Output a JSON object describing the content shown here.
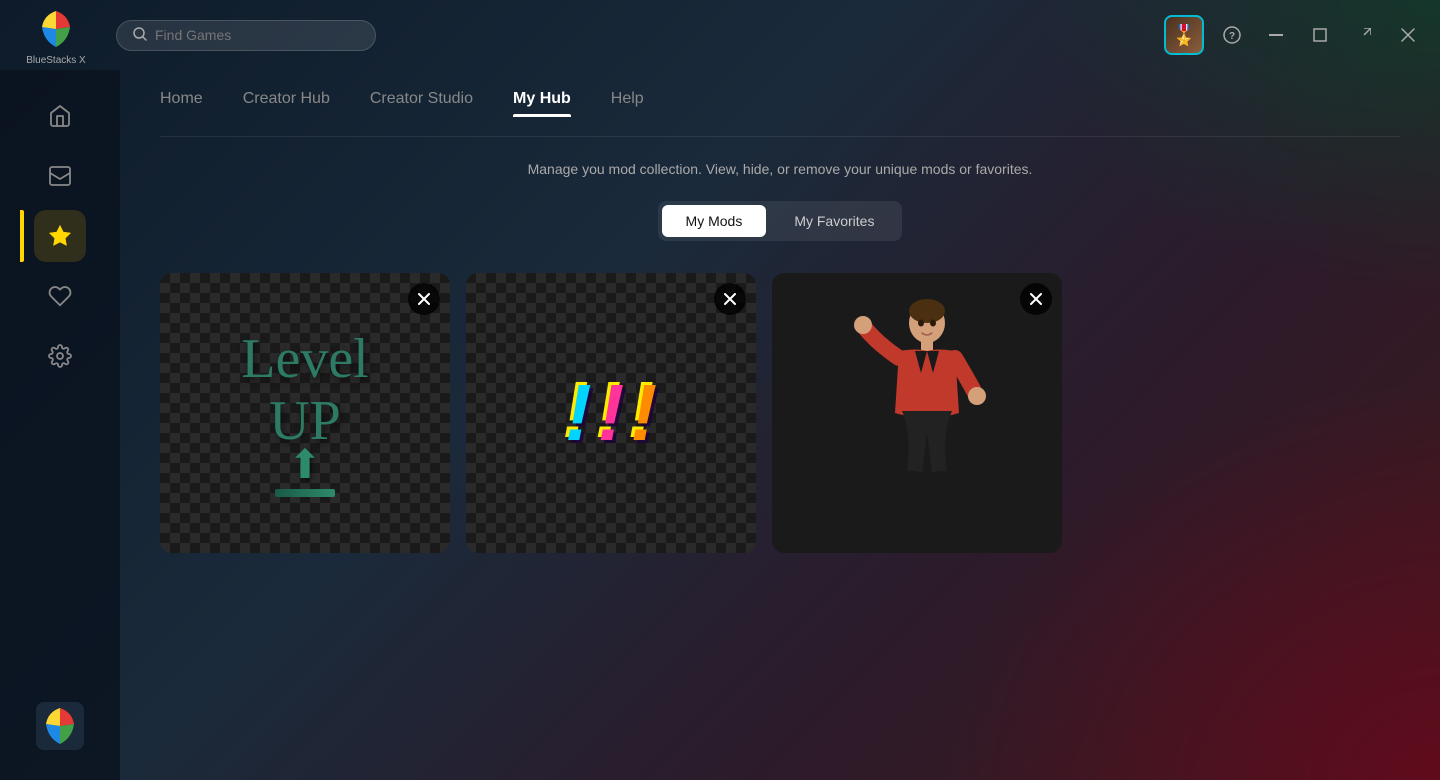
{
  "app": {
    "name": "BlueStacks X",
    "logo_text": "BlueStacks X"
  },
  "search": {
    "placeholder": "Find Games"
  },
  "titlebar": {
    "help_label": "?",
    "minimize_label": "─",
    "maximize_label": "□",
    "restore_label": "⇗",
    "close_label": "✕",
    "avatar_emoji": "🎖️"
  },
  "sidebar": {
    "items": [
      {
        "id": "home",
        "icon": "⌂",
        "label": "Home"
      },
      {
        "id": "inbox",
        "icon": "⊡",
        "label": "Inbox"
      },
      {
        "id": "myhub",
        "icon": "★",
        "label": "My Hub",
        "active": true
      },
      {
        "id": "favorites",
        "icon": "♡",
        "label": "Favorites"
      },
      {
        "id": "settings",
        "icon": "⚙",
        "label": "Settings"
      }
    ]
  },
  "nav": {
    "tabs": [
      {
        "id": "home",
        "label": "Home",
        "active": false
      },
      {
        "id": "creator-hub",
        "label": "Creator Hub",
        "active": false
      },
      {
        "id": "creator-studio",
        "label": "Creator Studio",
        "active": false
      },
      {
        "id": "my-hub",
        "label": "My Hub",
        "active": true
      },
      {
        "id": "help",
        "label": "Help",
        "active": false
      }
    ]
  },
  "main": {
    "subtitle": "Manage you mod collection. View, hide, or remove your unique mods or favorites.",
    "toggle": {
      "my_mods": "My Mods",
      "my_favorites": "My Favorites"
    },
    "active_toggle": "my_mods",
    "mods": [
      {
        "id": "mod1",
        "type": "level-up",
        "label": "Level Up Mod"
      },
      {
        "id": "mod2",
        "type": "exclamations",
        "label": "Exclamation Mod"
      },
      {
        "id": "mod3",
        "type": "dancer",
        "label": "Dancer Mod"
      }
    ]
  }
}
